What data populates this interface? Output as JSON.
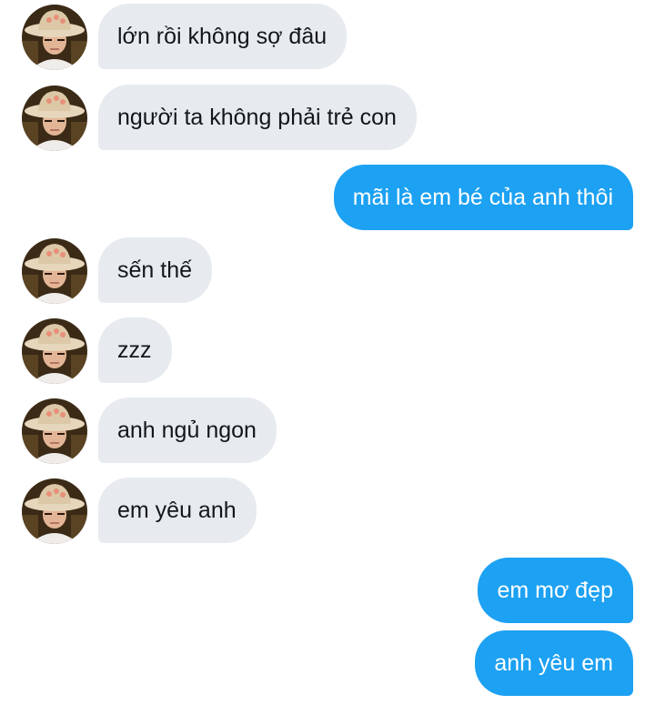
{
  "conversation": {
    "messages": [
      {
        "direction": "in",
        "text": "lớn rồi không sợ đâu"
      },
      {
        "direction": "in",
        "text": "người ta không phải trẻ con"
      },
      {
        "direction": "out",
        "text": "mãi là em bé của anh thôi"
      },
      {
        "direction": "in",
        "text": "sến thế"
      },
      {
        "direction": "in",
        "text": "zzz"
      },
      {
        "direction": "in",
        "text": "anh ngủ ngon"
      },
      {
        "direction": "in",
        "text": "em yêu anh"
      },
      {
        "direction": "out",
        "text": "em mơ đẹp"
      },
      {
        "direction": "out",
        "text": "anh yêu em"
      }
    ]
  },
  "colors": {
    "incoming_bubble": "#e7ebef",
    "incoming_text": "#14171a",
    "outgoing_bubble": "#1da1f2",
    "outgoing_text": "#ffffff"
  },
  "icons": {
    "avatar": "contact-avatar-photo"
  }
}
